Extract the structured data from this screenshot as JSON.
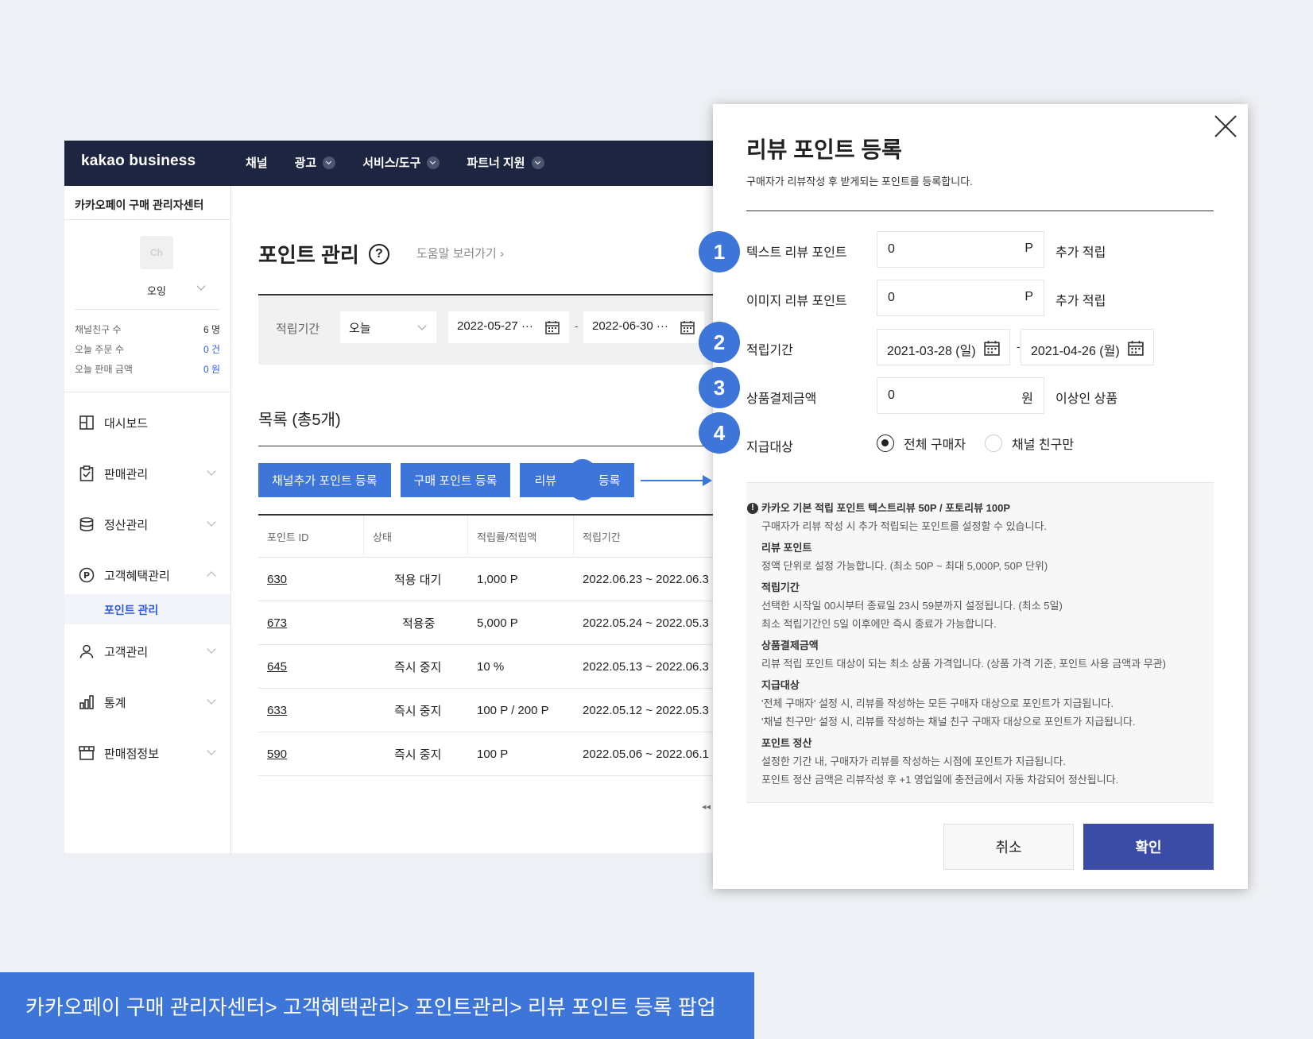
{
  "topbar": {
    "brand": "kakao business",
    "nav": [
      {
        "label": "채널",
        "dropdown": false
      },
      {
        "label": "광고",
        "dropdown": true
      },
      {
        "label": "서비스/도구",
        "dropdown": true
      },
      {
        "label": "파트너 지원",
        "dropdown": true
      }
    ]
  },
  "sidebar": {
    "title": "카카오페이 구매 관리자센터",
    "profile": {
      "avatar_text": "Ch",
      "name": "오잉"
    },
    "stats": [
      {
        "label": "채널친구 수",
        "value": "6 명"
      },
      {
        "label": "오늘 주문 수",
        "value": "0 건"
      },
      {
        "label": "오늘 판매 금액",
        "value": "0 원"
      }
    ],
    "menu": [
      {
        "label": "대시보드",
        "icon": "dashboard-icon"
      },
      {
        "label": "판매관리",
        "icon": "clipboard-icon"
      },
      {
        "label": "정산관리",
        "icon": "database-icon"
      },
      {
        "label": "고객혜택관리",
        "icon": "point-icon",
        "expanded": true
      },
      {
        "label": "고객관리",
        "icon": "user-icon"
      },
      {
        "label": "통계",
        "icon": "chart-icon"
      },
      {
        "label": "판매점정보",
        "icon": "store-icon"
      }
    ],
    "active_sub": "포인트 관리"
  },
  "main": {
    "title": "포인트 관리",
    "help_link": "도움말 보러가기",
    "filter": {
      "label": "적립기간",
      "select": "오늘",
      "date_from": "2022-05-27 ···",
      "date_to": "2022-06-30 ···",
      "dash": "-"
    },
    "list_title": "목록 (총5개)",
    "buttons": {
      "channel": "채널추가 포인트 등록",
      "purchase": "구매 포인트 등록",
      "review_left": "리뷰",
      "review_right": "등록"
    },
    "table": {
      "headers": [
        "포인트 ID",
        "상태",
        "적립률/적립액",
        "적립기간"
      ],
      "rows": [
        {
          "id": "630",
          "status": "적용 대기",
          "rate": "1,000 P",
          "period": "2022.06.23 ~ 2022.06.3"
        },
        {
          "id": "673",
          "status": "적용중",
          "rate": "5,000 P",
          "period": "2022.05.24 ~ 2022.05.3"
        },
        {
          "id": "645",
          "status": "즉시 중지",
          "rate": "10 %",
          "period": "2022.05.13 ~ 2022.06.3"
        },
        {
          "id": "633",
          "status": "즉시 중지",
          "rate": "100 P / 200 P",
          "period": "2022.05.12 ~ 2022.05.3"
        },
        {
          "id": "590",
          "status": "즉시 중지",
          "rate": "100 P",
          "period": "2022.05.06 ~ 2022.06.1"
        }
      ]
    },
    "pager": "◂◂"
  },
  "modal": {
    "title": "리뷰 포인트 등록",
    "description": "구매자가 리뷰작성 후 받게되는 포인트를 등록합니다.",
    "fields": {
      "text_review": {
        "label": "텍스트 리뷰 포인트",
        "value": "0",
        "unit": "P",
        "suffix": "추가 적립"
      },
      "image_review": {
        "label": "이미지 리뷰 포인트",
        "value": "0",
        "unit": "P",
        "suffix": "추가 적립"
      },
      "period": {
        "label": "적립기간",
        "from": "2021-03-28 (일)",
        "to": "2021-04-26 (월)",
        "dash": "-"
      },
      "amount": {
        "label": "상품결제금액",
        "value": "0",
        "unit": "원",
        "suffix": "이상인 상품"
      },
      "target": {
        "label": "지급대상",
        "options": [
          {
            "label": "전체 구매자",
            "selected": true
          },
          {
            "label": "채널 친구만",
            "selected": false
          }
        ]
      }
    },
    "info": {
      "head": "카카오 기본 적립 포인트 텍스트리뷰 50P / 포토리뷰 100P",
      "head_text": "구매자가 리뷰 작성 시 추가 적립되는 포인트를 설정할 수 있습니다.",
      "sections": [
        {
          "title": "리뷰 포인트",
          "lines": [
            "정액 단위로 설정 가능합니다. (최소 50P ~ 최대 5,000P, 50P 단위)"
          ]
        },
        {
          "title": "적립기간",
          "lines": [
            "선택한 시작일 00시부터 종료일 23시 59분까지 설정됩니다. (최소 5일)",
            "최소 적립기간인 5일 이후에만 즉시 종료가 가능합니다."
          ]
        },
        {
          "title": "상품결제금액",
          "lines": [
            "리뷰 적립 포인트 대상이 되는 최소 상품 가격입니다. (상품 가격 기준, 포인트 사용 금액과 무관)"
          ]
        },
        {
          "title": "지급대상",
          "lines": [
            "'전체 구매자' 설정 시, 리뷰를 작성하는 모든 구매자 대상으로 포인트가 지급됩니다.",
            "'채널 친구만' 설정 시, 리뷰를 작성하는 채널 친구 구매자 대상으로 포인트가 지급됩니다."
          ]
        },
        {
          "title": "포인트 정산",
          "lines": [
            "설정한 기간 내, 구매자가 리뷰를 작성하는 시점에 포인트가 지급됩니다.",
            "포인트 정산 금액은 리뷰작성 후 +1 영업일에 충전금에서 자동 차감되어 정산됩니다."
          ]
        }
      ]
    },
    "cancel": "취소",
    "confirm": "확인"
  },
  "annotations": [
    "1",
    "2",
    "3",
    "4"
  ],
  "caption": "카카오페이 구매 관리자센터> 고객혜택관리> 포인트관리> 리뷰 포인트 등록 팝업",
  "colors": {
    "accent": "#3d75d9",
    "topbar": "#1d2540",
    "confirm": "#3b4ca7"
  }
}
